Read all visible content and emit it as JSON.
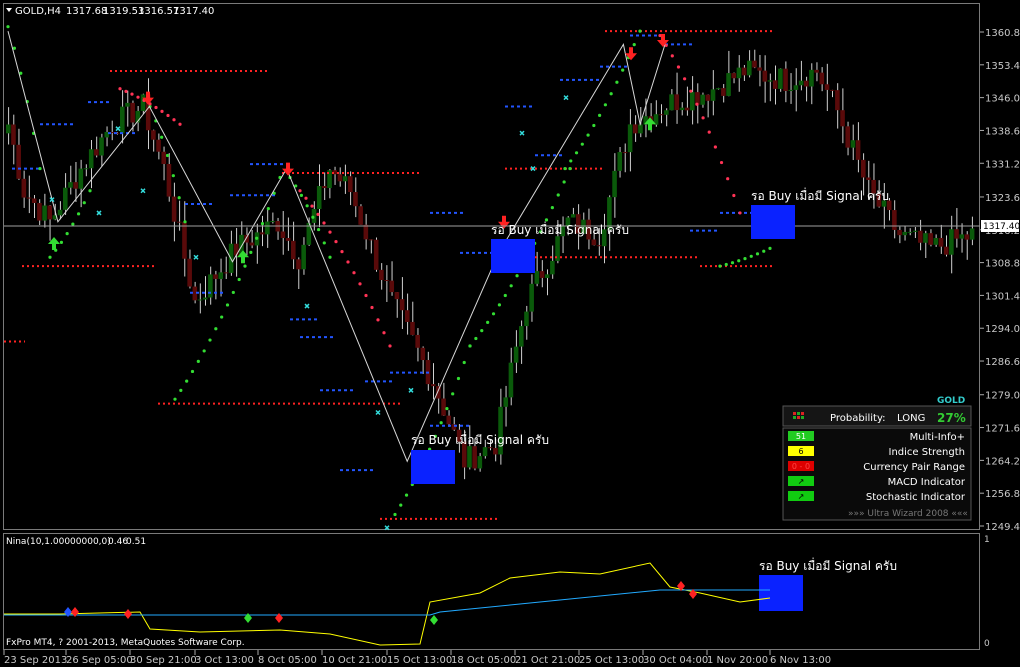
{
  "header": {
    "symbol": "GOLD,H4",
    "o": "1317.68",
    "h": "1319.53",
    "l": "1316.57",
    "c": "1317.40"
  },
  "sub_header": {
    "indicator_label": "Nina(10,1.00000000,0)",
    "v1": "0.46",
    "v2": "0.51"
  },
  "footer": {
    "copyright": "FxPro MT4, ? 2001-2013, MetaQuotes Software Corp."
  },
  "annotations": {
    "main_signal_1": "รอ Buy เมื่อมี Signal ครับ",
    "main_signal_2": "รอ Buy เมื่อมี Signal ครับ",
    "main_signal_3": "รอ Buy เมื่อมี Signal ครับ",
    "sub_signal": "รอ Buy เมื่อมี Signal ครับ"
  },
  "info_panel": {
    "symbol": "GOLD",
    "probability_label": "Probability:",
    "direction": "LONG",
    "percent": "27%",
    "rows": [
      {
        "badge": "51",
        "label": "Multi-Info+",
        "badge_color": "#22cc22",
        "text_color": "#ffffff"
      },
      {
        "badge": "6",
        "label": "Indice Strength",
        "badge_color": "#ffff00",
        "text_color": "#000000"
      },
      {
        "badge": "0 - 0",
        "label": "Currency Pair Range",
        "badge_color": "#dd0000",
        "text_color": "#ff4444"
      },
      {
        "badge": "↗",
        "label": "MACD Indicator",
        "badge_color": "#11cc11",
        "text_color": "#000000"
      },
      {
        "badge": "↗",
        "label": "Stochastic Indicator",
        "badge_color": "#11cc11",
        "text_color": "#000000"
      }
    ],
    "footer": "»»» Ultra Wizard 2008 «««"
  },
  "colors": {
    "bull": "#0a5a0a",
    "bear": "#5a0a0a",
    "up_arrow": "#33dd33",
    "down_arrow": "#ff2222",
    "dots_green": "#33dd33",
    "dots_red": "#ff3355",
    "blue_level": "#2255ff",
    "red_level": "#ff2222",
    "signal_box": "#0a22ff",
    "sub_yellow": "#ffff00",
    "sub_blue": "#22aaff"
  },
  "chart_data": {
    "type": "line",
    "y_ticks": [
      "1360.80",
      "1353.40",
      "1346.00",
      "1338.60",
      "1331.20",
      "1323.60",
      "1316.20",
      "1308.80",
      "1301.40",
      "1294.00",
      "1286.60",
      "1279.00",
      "1271.60",
      "1264.20",
      "1256.80",
      "1249.40"
    ],
    "ylim": [
      1247,
      1365
    ],
    "current_price": "1317.40",
    "x_ticks": [
      "23 Sep 2013",
      "26 Sep 05:00",
      "30 Sep 21:00",
      "3 Oct 13:00",
      "8 Oct 05:00",
      "10 Oct 21:00",
      "15 Oct 13:00",
      "18 Oct 05:00",
      "21 Oct 21:00",
      "25 Oct 13:00",
      "30 Oct 04:00",
      "1 Nov 20:00",
      "6 Nov 13:00"
    ],
    "sub_y_ticks": [
      "1",
      "0"
    ],
    "zigzag": [
      {
        "x": 0,
        "y": 1361
      },
      {
        "x": 12,
        "y": 1318
      },
      {
        "x": 34,
        "y": 1344
      },
      {
        "x": 54,
        "y": 1309
      },
      {
        "x": 67,
        "y": 1330
      },
      {
        "x": 96,
        "y": 1264
      },
      {
        "x": 118,
        "y": 1311
      },
      {
        "x": 148,
        "y": 1358
      },
      {
        "x": 152,
        "y": 1340
      },
      {
        "x": 158,
        "y": 1358
      }
    ]
  }
}
